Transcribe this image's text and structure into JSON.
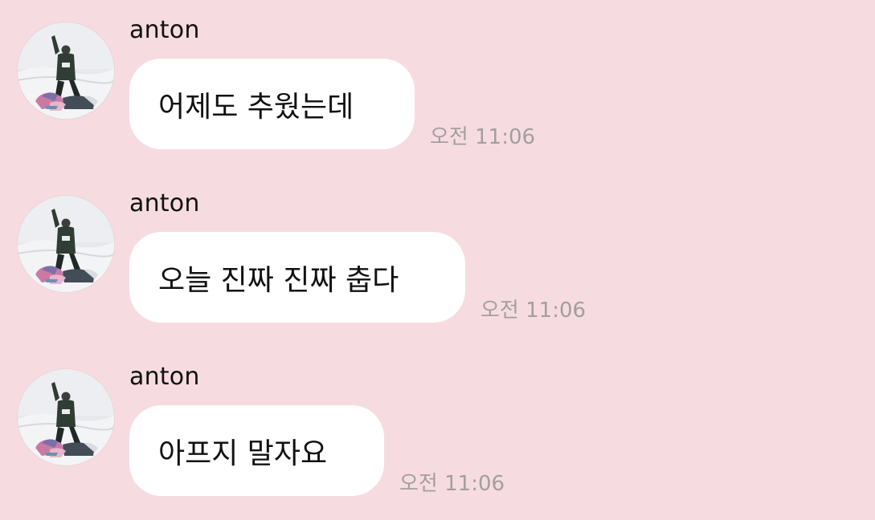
{
  "chat": {
    "messages": [
      {
        "sender": "anton",
        "text": "어제도 추웠는데",
        "time": "오전 11:06",
        "avatar_icon": "profile-photo-person-on-snowmobile"
      },
      {
        "sender": "anton",
        "text": "오늘 진짜 진짜 춥다",
        "time": "오전 11:06",
        "avatar_icon": "profile-photo-person-on-snowmobile"
      },
      {
        "sender": "anton",
        "text": "아프지 말자요",
        "time": "오전 11:06",
        "avatar_icon": "profile-photo-person-on-snowmobile"
      }
    ]
  },
  "colors": {
    "background": "#f6dce1",
    "bubble": "#ffffff",
    "text": "#111111",
    "timestamp": "#a39ea0"
  }
}
